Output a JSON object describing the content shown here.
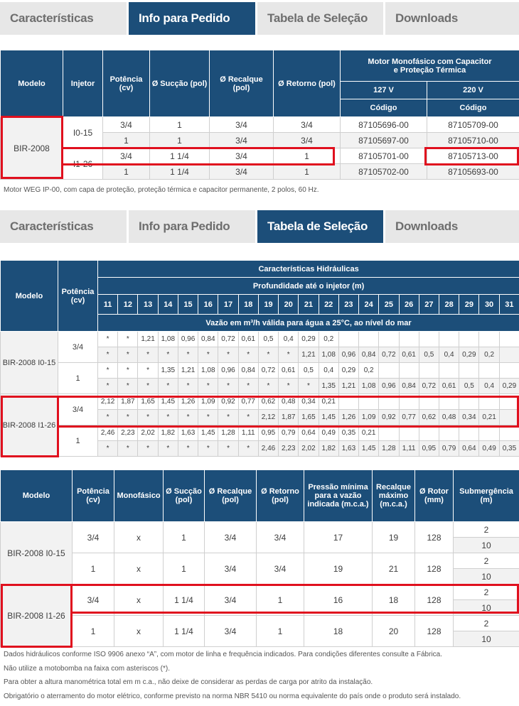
{
  "tabs1": [
    "Características",
    "Info para Pedido",
    "Tabela de Seleção",
    "Downloads"
  ],
  "tabs2": [
    "Características",
    "Info para Pedido",
    "Tabela de Seleção",
    "Downloads"
  ],
  "order_table": {
    "headers": {
      "modelo": "Modelo",
      "injetor": "Injetor",
      "potencia": "Potência (cv)",
      "succao": "Ø Sucção (pol)",
      "recalque": "Ø Recalque (pol)",
      "retorno": "Ø Retorno (pol)",
      "motor_l1": "Motor Monofásico com Capacitor",
      "motor_l2": "e Proteção Térmica",
      "v127": "127 V",
      "v220": "220 V",
      "codigo": "Código"
    },
    "model": "BIR-2008",
    "injectors": [
      "I0-15",
      "I1-26"
    ],
    "rows": [
      [
        "3/4",
        "1",
        "3/4",
        "3/4",
        "87105696-00",
        "87105709-00"
      ],
      [
        "1",
        "1",
        "3/4",
        "3/4",
        "87105697-00",
        "87105710-00"
      ],
      [
        "3/4",
        "1 1/4",
        "3/4",
        "1",
        "87105701-00",
        "87105713-00"
      ],
      [
        "1",
        "1 1/4",
        "3/4",
        "1",
        "87105702-00",
        "87105693-00"
      ]
    ],
    "note": "Motor WEG IP-00, com capa de proteção, proteção térmica e capacitor permanente, 2 polos, 60 Hz."
  },
  "hydraulic_table": {
    "headers": {
      "modelo": "Modelo",
      "potencia": "Potência (cv)",
      "caracteristicas": "Características Hidráulicas",
      "profundidade": "Profundidade até o injetor (m)",
      "vazao": "Vazão em m³/h válida para água a 25°C, ao nível do mar"
    },
    "depths": [
      "11",
      "12",
      "13",
      "14",
      "15",
      "16",
      "17",
      "18",
      "19",
      "20",
      "21",
      "22",
      "23",
      "24",
      "25",
      "26",
      "27",
      "28",
      "29",
      "30",
      "31"
    ],
    "groups": [
      {
        "model": "BIR-2008 I0-15",
        "rows": [
          {
            "pot": "3/4",
            "lines": [
              [
                "*",
                "*",
                "1,21",
                "1,08",
                "0,96",
                "0,84",
                "0,72",
                "0,61",
                "0,5",
                "0,4",
                "0,29",
                "0,2",
                "",
                "",
                "",
                "",
                "",
                "",
                "",
                "",
                ""
              ],
              [
                "*",
                "*",
                "*",
                "*",
                "*",
                "*",
                "*",
                "*",
                "*",
                "*",
                "1,21",
                "1,08",
                "0,96",
                "0,84",
                "0,72",
                "0,61",
                "0,5",
                "0,4",
                "0,29",
                "0,2",
                ""
              ]
            ]
          },
          {
            "pot": "1",
            "lines": [
              [
                "*",
                "*",
                "*",
                "1,35",
                "1,21",
                "1,08",
                "0,96",
                "0,84",
                "0,72",
                "0,61",
                "0,5",
                "0,4",
                "0,29",
                "0,2",
                "",
                "",
                "",
                "",
                "",
                "",
                ""
              ],
              [
                "*",
                "*",
                "*",
                "*",
                "*",
                "*",
                "*",
                "*",
                "*",
                "*",
                "*",
                "1,35",
                "1,21",
                "1,08",
                "0,96",
                "0,84",
                "0,72",
                "0,61",
                "0,5",
                "0,4",
                "0,29"
              ]
            ]
          }
        ]
      },
      {
        "model": "BIR-2008 I1-26",
        "rows": [
          {
            "pot": "3/4",
            "lines": [
              [
                "2,12",
                "1,87",
                "1,65",
                "1,45",
                "1,26",
                "1,09",
                "0,92",
                "0,77",
                "0,62",
                "0,48",
                "0,34",
                "0,21",
                "",
                "",
                "",
                "",
                "",
                "",
                "",
                "",
                ""
              ],
              [
                "*",
                "*",
                "*",
                "*",
                "*",
                "*",
                "*",
                "*",
                "2,12",
                "1,87",
                "1,65",
                "1,45",
                "1,26",
                "1,09",
                "0,92",
                "0,77",
                "0,62",
                "0,48",
                "0,34",
                "0,21",
                ""
              ]
            ]
          },
          {
            "pot": "1",
            "lines": [
              [
                "2,46",
                "2,23",
                "2,02",
                "1,82",
                "1,63",
                "1,45",
                "1,28",
                "1,11",
                "0,95",
                "0,79",
                "0,64",
                "0,49",
                "0,35",
                "0,21",
                "",
                "",
                "",
                "",
                "",
                "",
                ""
              ],
              [
                "*",
                "*",
                "*",
                "*",
                "*",
                "*",
                "*",
                "*",
                "2,46",
                "2,23",
                "2,02",
                "1,82",
                "1,63",
                "1,45",
                "1,28",
                "1,11",
                "0,95",
                "0,79",
                "0,64",
                "0,49",
                "0,35"
              ]
            ]
          }
        ]
      }
    ]
  },
  "spec_table": {
    "headers": {
      "modelo": "Modelo",
      "potencia": "Potência (cv)",
      "monofasico": "Monofásico",
      "succao": "Ø Sucção (pol)",
      "recalque": "Ø Recalque (pol)",
      "retorno": "Ø Retorno (pol)",
      "pressao": "Pressão mínima para a vazão indicada (m.c.a.)",
      "recalque_max": "Recalque máximo (m.c.a.)",
      "rotor": "Ø Rotor (mm)",
      "submergencia": "Submergência (m)"
    },
    "groups": [
      {
        "model": "BIR-2008 I0-15",
        "rows": [
          [
            "3/4",
            "x",
            "1",
            "3/4",
            "3/4",
            "17",
            "19",
            "128",
            "2",
            "10"
          ],
          [
            "1",
            "x",
            "1",
            "3/4",
            "3/4",
            "19",
            "21",
            "128",
            "2",
            "10"
          ]
        ]
      },
      {
        "model": "BIR-2008 I1-26",
        "rows": [
          [
            "3/4",
            "x",
            "1 1/4",
            "3/4",
            "1",
            "16",
            "18",
            "128",
            "2",
            "10"
          ],
          [
            "1",
            "x",
            "1 1/4",
            "3/4",
            "1",
            "18",
            "20",
            "128",
            "2",
            "10"
          ]
        ]
      }
    ]
  },
  "footnotes": [
    "Dados hidráulicos conforme ISO 9906 anexo “A”, com motor de linha e frequência indicados. Para condições diferentes consulte a Fábrica.",
    "Não utilize a motobomba na faixa com asteriscos (*).",
    "Para obter a altura manométrica total em m c.a., não deixe de considerar as perdas de carga por atrito da instalação.",
    "Obrigatório o aterramento do motor elétrico, conforme previsto na norma NBR 5410 ou norma equivalente do país onde o produto será instalado."
  ],
  "colors": {
    "header_blue": "#1c4e79",
    "highlight_red": "#e0101e",
    "tab_gray": "#e7e7e7"
  }
}
